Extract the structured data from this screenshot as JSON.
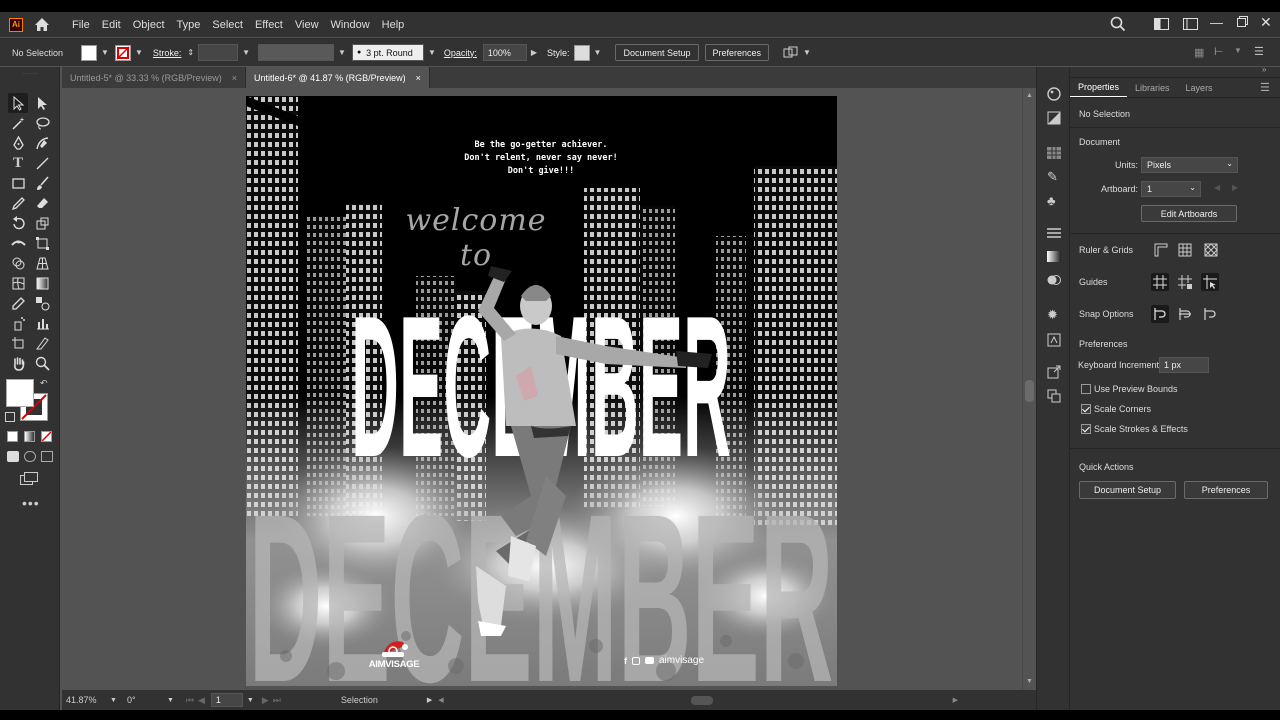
{
  "app": {
    "logo": "Ai"
  },
  "menus": [
    "File",
    "Edit",
    "Object",
    "Type",
    "Select",
    "Effect",
    "View",
    "Window",
    "Help"
  ],
  "control": {
    "selection": "No Selection",
    "stroke_label": "Stroke:",
    "brush": "3 pt. Round",
    "opacity_label": "Opacity:",
    "opacity_value": "100%",
    "style_label": "Style:",
    "document_setup": "Document Setup",
    "preferences": "Preferences"
  },
  "tabs": [
    {
      "label": "Untitled-5* @ 33.33 % (RGB/Preview)",
      "close": "×"
    },
    {
      "label": "Untitled-6* @ 41.87 % (RGB/Preview)",
      "close": "×"
    }
  ],
  "artwork": {
    "quote_line1": "Be the go-getter achiever.",
    "quote_line2": "Don't relent, never say never!",
    "quote_line3": "Don't give!!!",
    "script": "welcome to",
    "headline": "DECEMBER",
    "brand": "AIMVISAGE",
    "social": "aimvisage"
  },
  "status": {
    "zoom": "41.87%",
    "rotation": "0°",
    "artboard": "1",
    "tool": "Selection"
  },
  "panel": {
    "tabs": [
      "Properties",
      "Libraries",
      "Layers"
    ],
    "no_selection": "No Selection",
    "document": "Document",
    "units_label": "Units:",
    "units_value": "Pixels",
    "artboard_label": "Artboard:",
    "artboard_value": "1",
    "edit_artboards": "Edit Artboards",
    "ruler_grids": "Ruler & Grids",
    "guides": "Guides",
    "snap_options": "Snap Options",
    "preferences": "Preferences",
    "keyboard_increment_label": "Keyboard Increment:",
    "keyboard_increment_value": "1 px",
    "use_preview_bounds": "Use Preview Bounds",
    "scale_corners": "Scale Corners",
    "scale_strokes": "Scale Strokes & Effects",
    "quick_actions": "Quick Actions",
    "qa_document_setup": "Document Setup",
    "qa_preferences": "Preferences"
  },
  "checks": {
    "use_preview_bounds": false,
    "scale_corners": true,
    "scale_strokes": true
  }
}
